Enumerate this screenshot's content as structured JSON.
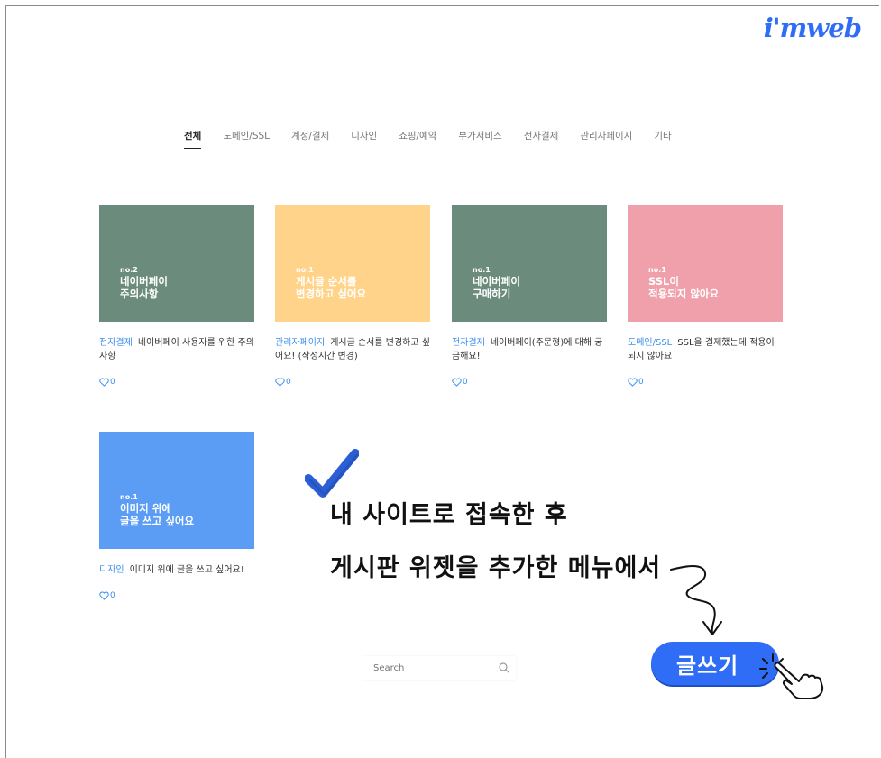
{
  "logo": "i'mweb",
  "categories": [
    "전체",
    "도메인/SSL",
    "계정/결제",
    "디자인",
    "쇼핑/예약",
    "부가서비스",
    "전자결제",
    "관리자페이지",
    "기타"
  ],
  "posts": [
    {
      "color": "#6b8b7d",
      "no": "no.2",
      "thumb_title": "네이버페이\n주의사항",
      "tag": "전자결제",
      "title": "네이버페이 사용자를 위한 주의사항",
      "likes": "0"
    },
    {
      "color": "#ffd38a",
      "no": "no.1",
      "thumb_title": "게시글 순서를\n변경하고 싶어요",
      "tag": "관리자페이지",
      "title": "게시글 순서를 변경하고 싶어요! (작성시간 변경)",
      "likes": "0"
    },
    {
      "color": "#6b8b7d",
      "no": "no.1",
      "thumb_title": "네이버페이\n구매하기",
      "tag": "전자결제",
      "title": "네이버페이(주문형)에 대해 궁금해요!",
      "likes": "0"
    },
    {
      "color": "#f0a0ab",
      "no": "no.1",
      "thumb_title": "SSL이\n적용되지 않아요",
      "tag": "도메인/SSL",
      "title": "SSL을 결제했는데 적용이 되지 않아요",
      "likes": "0"
    },
    {
      "color": "#5b9cf5",
      "no": "no.1",
      "thumb_title": "이미지 위에\n글을 쓰고 싶어요",
      "tag": "디자인",
      "title": "이미지 위에 글을 쓰고 싶어요!",
      "likes": "0"
    }
  ],
  "search": {
    "placeholder": "Search"
  },
  "annotation": {
    "line1": "내 사이트로 접속한 후",
    "line2": "게시판 위젯을 추가한 메뉴에서",
    "button": "글쓰기"
  }
}
